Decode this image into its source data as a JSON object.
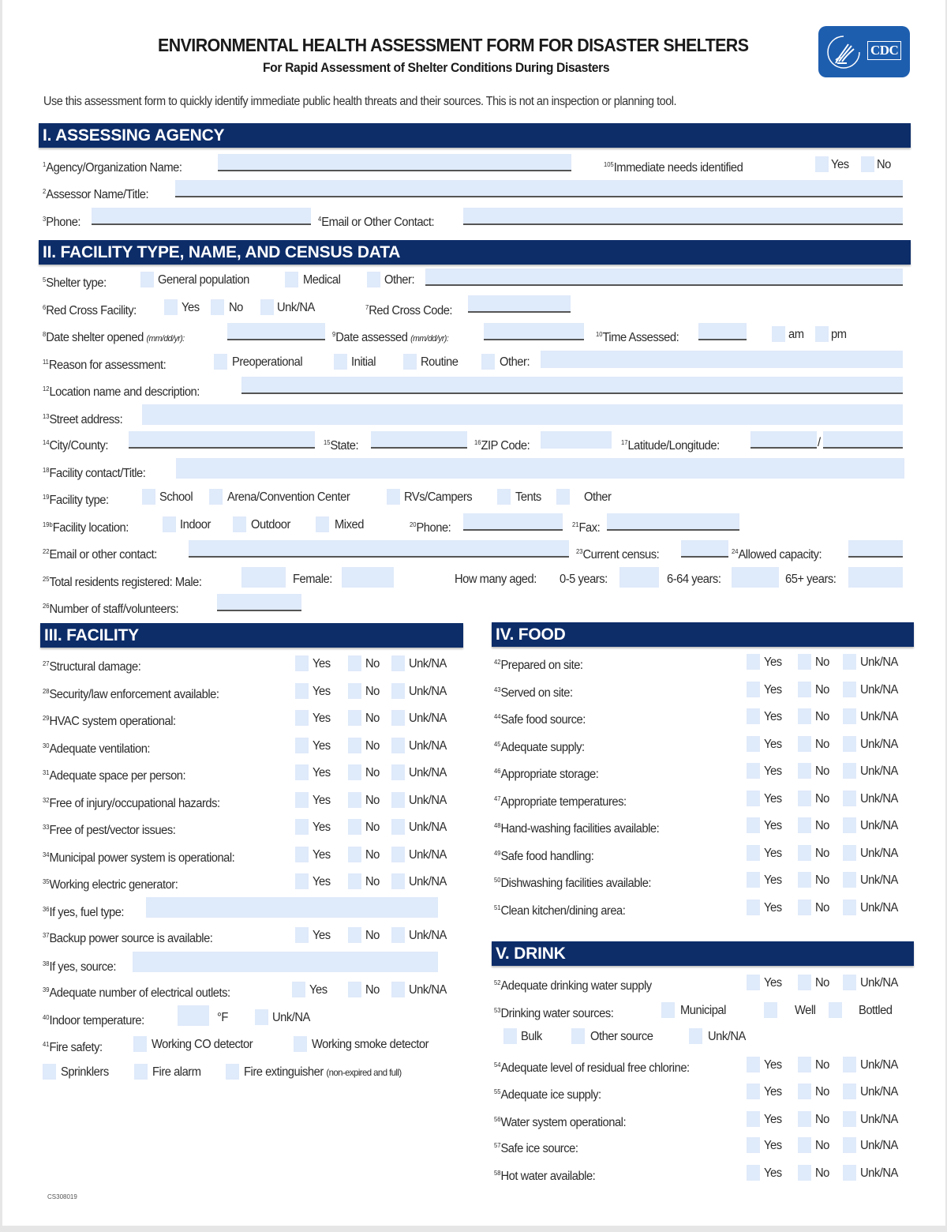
{
  "header": {
    "title": "ENVIRONMENTAL HEALTH ASSESSMENT FORM FOR DISASTER SHELTERS",
    "subtitle": "For Rapid Assessment of Shelter Conditions During Disasters",
    "logo_text": "CDC",
    "logo_icon": "hhs-eagle-icon",
    "brand_color": "#1e5eaf",
    "section_color": "#0d2d69",
    "field_color": "#dfeafa"
  },
  "intro": "Use this assessment form to quickly identify immediate public health threats and their sources. This is not an inspection or planning tool.",
  "sections": {
    "s1": {
      "title": "I. ASSESSING AGENCY",
      "agency": {
        "num": "1",
        "label": "Agency/Organization Name:",
        "value": ""
      },
      "needs": {
        "num": "105",
        "label": "Immediate needs identified",
        "options": [
          "Yes",
          "No"
        ]
      },
      "assessor": {
        "num": "2",
        "label": "Assessor Name/Title:",
        "value": ""
      },
      "phone": {
        "num": "3",
        "label": "Phone:",
        "value": ""
      },
      "email": {
        "num": "4",
        "label": "Email or Other Contact:",
        "value": ""
      }
    },
    "s2": {
      "title": "II. FACILITY TYPE, NAME, AND CENSUS DATA",
      "shelter_type": {
        "num": "5",
        "label": "Shelter type:",
        "options": [
          "General population",
          "Medical",
          "Other:"
        ]
      },
      "red_cross": {
        "num": "6",
        "label": "Red Cross Facility:",
        "options": [
          "Yes",
          "No",
          "Unk/NA"
        ]
      },
      "red_cross_code": {
        "num": "7",
        "label": "Red Cross Code:"
      },
      "date_opened": {
        "num": "8",
        "label": "Date shelter opened",
        "hint": "(mm/dd/yr):"
      },
      "date_assessed": {
        "num": "9",
        "label": "Date assessed",
        "hint": "(mm/dd/yr):"
      },
      "time_assessed": {
        "num": "10",
        "label": "Time Assessed:",
        "options": [
          "am",
          "pm"
        ]
      },
      "reason": {
        "num": "11",
        "label": "Reason for assessment:",
        "options": [
          "Preoperational",
          "Initial",
          "Routine",
          "Other:"
        ]
      },
      "location": {
        "num": "12",
        "label": "Location name and description:"
      },
      "street": {
        "num": "13",
        "label": "Street address:"
      },
      "city": {
        "num": "14",
        "label": "City/County:"
      },
      "state": {
        "num": "15",
        "label": "State:"
      },
      "zip": {
        "num": "16",
        "label": "ZIP Code:"
      },
      "latlong": {
        "num": "17",
        "label": "Latitude/Longitude:",
        "separator": "/"
      },
      "contact": {
        "num": "18",
        "label": "Facility contact/Title:"
      },
      "facility_type": {
        "num": "19",
        "label": "Facility type:",
        "options": [
          "School",
          "Arena/Convention Center",
          "RVs/Campers",
          "Tents",
          "Other"
        ]
      },
      "facility_location": {
        "num": "19b",
        "label": "Facility location:",
        "options": [
          "Indoor",
          "Outdoor",
          "Mixed"
        ]
      },
      "phone": {
        "num": "20",
        "label": "Phone:"
      },
      "fax": {
        "num": "21",
        "label": "Fax:"
      },
      "email": {
        "num": "22",
        "label": "Email or other contact:"
      },
      "census": {
        "num": "23",
        "label": "Current census:"
      },
      "capacity": {
        "num": "24",
        "label": "Allowed capacity:"
      },
      "residents": {
        "num": "25",
        "label": "Total residents registered: Male:",
        "female": "Female:",
        "aged": "How many aged:",
        "age1": "0-5 years:",
        "age2": "6-64 years:",
        "age3": "65+ years:"
      },
      "staff": {
        "num": "26",
        "label": "Number of staff/volunteers:"
      }
    },
    "s3": {
      "title": "III. FACILITY",
      "yna": [
        "Yes",
        "No",
        "Unk/NA"
      ],
      "rows": [
        {
          "num": "27",
          "label": "Structural damage:"
        },
        {
          "num": "28",
          "label": "Security/law enforcement available:"
        },
        {
          "num": "29",
          "label": "HVAC system operational:"
        },
        {
          "num": "30",
          "label": "Adequate ventilation:"
        },
        {
          "num": "31",
          "label": "Adequate space per person:"
        },
        {
          "num": "32",
          "label": "Free of injury/occupational hazards:"
        },
        {
          "num": "33",
          "label": "Free of pest/vector issues:"
        },
        {
          "num": "34",
          "label": "Municipal power system is operational:"
        },
        {
          "num": "35",
          "label": "Working electric generator:"
        }
      ],
      "fuel": {
        "num": "36",
        "label": "If yes, fuel type:"
      },
      "backup": {
        "num": "37",
        "label": "Backup power source is available:"
      },
      "source": {
        "num": "38",
        "label": "If yes, source:"
      },
      "outlets": {
        "num": "39",
        "label": "Adequate number of electrical outlets:"
      },
      "temp": {
        "num": "40",
        "label": "Indoor temperature:",
        "unit": "°F",
        "na": "Unk/NA"
      },
      "fire": {
        "num": "41",
        "label": "Fire safety:",
        "options": [
          "Working CO detector",
          "Working smoke detector",
          "Sprinklers",
          "Fire alarm",
          "Fire extinguisher"
        ],
        "ext_hint": "(non-expired and full)"
      }
    },
    "s4": {
      "title": "IV. FOOD",
      "rows": [
        {
          "num": "42",
          "label": "Prepared on site:"
        },
        {
          "num": "43",
          "label": "Served on site:"
        },
        {
          "num": "44",
          "label": "Safe food source:"
        },
        {
          "num": "45",
          "label": "Adequate supply:"
        },
        {
          "num": "46",
          "label": "Appropriate storage:"
        },
        {
          "num": "47",
          "label": "Appropriate temperatures:"
        },
        {
          "num": "48",
          "label": "Hand-washing facilities available:"
        },
        {
          "num": "49",
          "label": "Safe food handling:"
        },
        {
          "num": "50",
          "label": "Dishwashing facilities available:"
        },
        {
          "num": "51",
          "label": "Clean kitchen/dining area:"
        }
      ]
    },
    "s5": {
      "title": "V. DRINK",
      "supply": {
        "num": "52",
        "label": "Adequate drinking water supply"
      },
      "sources": {
        "num": "53",
        "label": "Drinking water sources:",
        "options": [
          "Municipal",
          "Well",
          "Bottled",
          "Bulk",
          "Other source",
          "Unk/NA"
        ]
      },
      "rows": [
        {
          "num": "54",
          "label": "Adequate level of residual free chlorine:"
        },
        {
          "num": "55",
          "label": "Adequate ice supply:"
        },
        {
          "num": "56",
          "label": "Water system operational:"
        },
        {
          "num": "57",
          "label": "Safe ice source:"
        },
        {
          "num": "58",
          "label": "Hot water available:"
        }
      ]
    }
  },
  "footer_code": "CS308019"
}
